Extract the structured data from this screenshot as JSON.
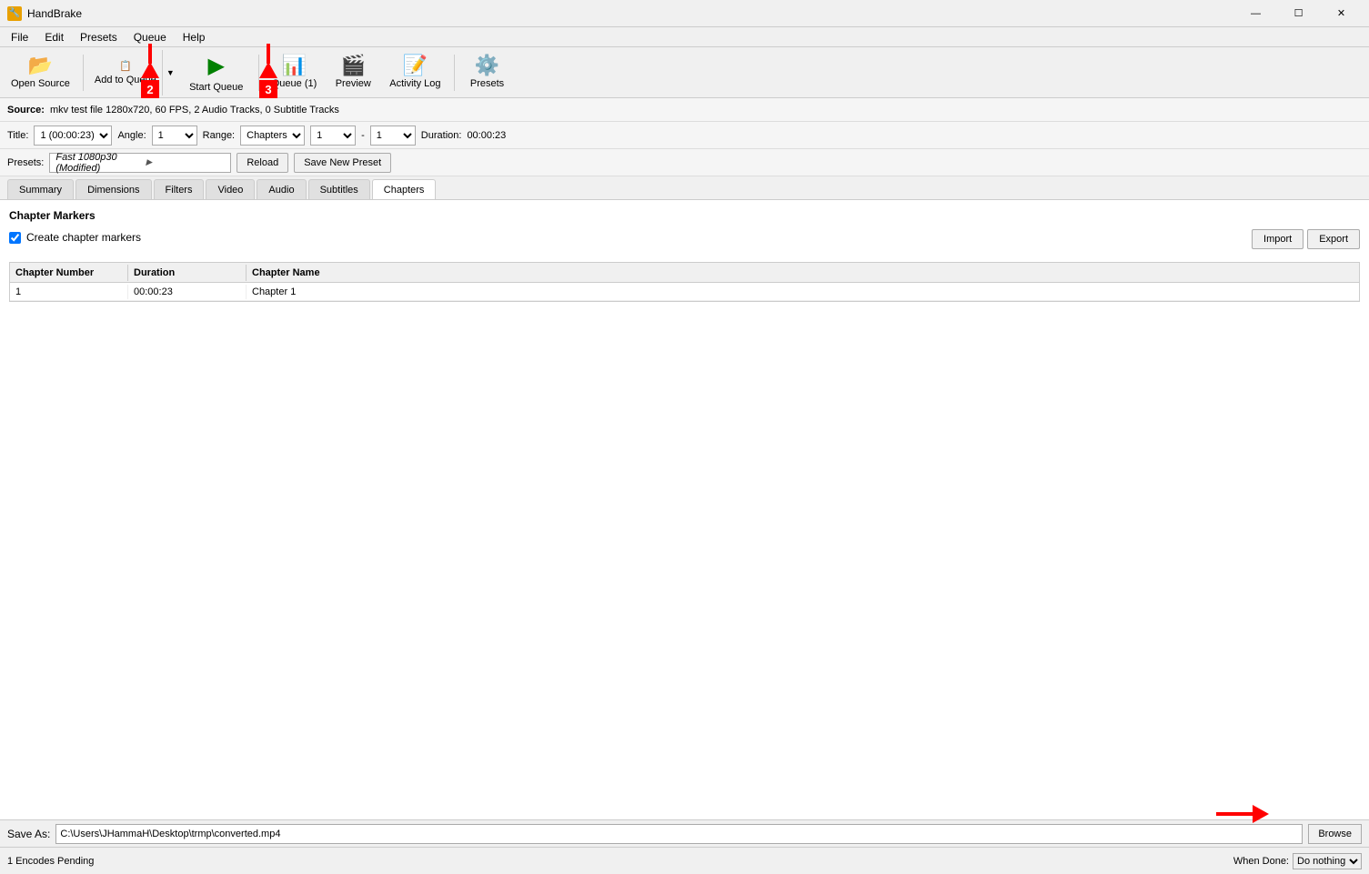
{
  "app": {
    "title": "HandBrake",
    "icon": "🔧"
  },
  "titlebar": {
    "minimize": "—",
    "maximize": "☐",
    "close": "✕"
  },
  "menubar": {
    "items": [
      "File",
      "Edit",
      "Presets",
      "Queue",
      "Help"
    ]
  },
  "toolbar": {
    "open_source": "Open Source",
    "add_to_queue": "Add to Queue",
    "start_queue": "Start Queue",
    "queue_count": "Queue (1)",
    "preview": "Preview",
    "activity_log": "Activity Log",
    "presets": "Presets"
  },
  "source": {
    "label": "Source:",
    "value": "mkv test file  1280x720, 60 FPS, 2 Audio Tracks, 0 Subtitle Tracks"
  },
  "title_row": {
    "title_label": "Title:",
    "title_value": "1 (00:00:23)",
    "angle_label": "Angle:",
    "angle_value": "1",
    "range_label": "Range:",
    "range_type": "Chapters",
    "range_start": "1",
    "range_end": "1",
    "duration_label": "Duration:",
    "duration_value": "00:00:23"
  },
  "presets_row": {
    "label": "Presets:",
    "value": "Fast 1080p30",
    "modified": "(Modified)",
    "reload_label": "Reload",
    "save_new_label": "Save New Preset"
  },
  "tabs": [
    {
      "id": "summary",
      "label": "Summary"
    },
    {
      "id": "dimensions",
      "label": "Dimensions"
    },
    {
      "id": "filters",
      "label": "Filters"
    },
    {
      "id": "video",
      "label": "Video"
    },
    {
      "id": "audio",
      "label": "Audio"
    },
    {
      "id": "subtitles",
      "label": "Subtitles"
    },
    {
      "id": "chapters",
      "label": "Chapters",
      "active": true
    }
  ],
  "chapters_panel": {
    "header": "Chapter Markers",
    "checkbox_label": "Create chapter markers",
    "checkbox_checked": true,
    "import_label": "Import",
    "export_label": "Export",
    "table_headers": [
      "Chapter Number",
      "Duration",
      "Chapter Name"
    ],
    "rows": [
      {
        "number": "1",
        "duration": "00:00:23",
        "name": "Chapter 1"
      }
    ]
  },
  "save_as": {
    "label": "Save As:",
    "value": "C:\\Users\\JHammaH\\Desktop\\trmp\\converted.mp4",
    "browse_label": "Browse"
  },
  "status_bar": {
    "left": "1 Encodes Pending",
    "when_done_label": "When Done:",
    "when_done_value": "Do nothing"
  },
  "annotations": [
    {
      "id": "2",
      "label": "2"
    },
    {
      "id": "3",
      "label": "3"
    }
  ]
}
